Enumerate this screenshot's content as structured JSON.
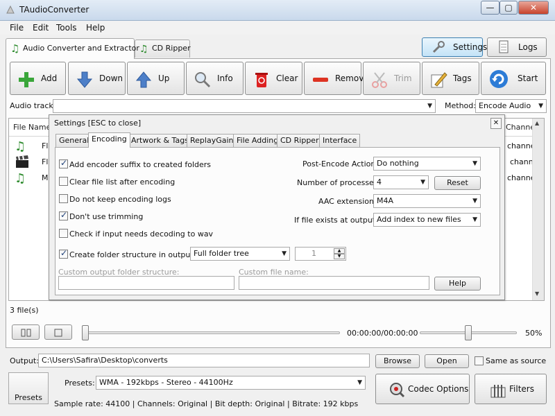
{
  "window": {
    "title": "TAudioConverter",
    "minimize": "—",
    "maximize": "▢",
    "close": "✕"
  },
  "menu": [
    "File",
    "Edit",
    "Tools",
    "Help"
  ],
  "main_tabs": [
    {
      "label": "Audio Converter and Extractor",
      "icon": "music-note-icon",
      "active": true
    },
    {
      "label": "CD Ripper",
      "icon": "music-note-icon",
      "active": false
    }
  ],
  "top_buttons": {
    "settings": "Settings",
    "logs": "Logs"
  },
  "toolbar": [
    {
      "label": "Add",
      "icon": "plus-icon",
      "enabled": true
    },
    {
      "label": "Down",
      "icon": "arrow-down-icon",
      "enabled": true
    },
    {
      "label": "Up",
      "icon": "arrow-up-icon",
      "enabled": true
    },
    {
      "label": "Info",
      "icon": "magnifier-icon",
      "enabled": true
    },
    {
      "label": "Clear",
      "icon": "trash-icon",
      "enabled": true
    },
    {
      "label": "Remove",
      "icon": "minus-icon",
      "enabled": true
    },
    {
      "label": "Trim",
      "icon": "scissors-icon",
      "enabled": false
    },
    {
      "label": "Tags",
      "icon": "pencil-icon",
      "enabled": true
    },
    {
      "label": "Start",
      "icon": "refresh-icon",
      "enabled": true
    }
  ],
  "audio_track": {
    "label": "Audio track:",
    "value": ""
  },
  "method": {
    "label": "Method:",
    "value": "Encode Audio"
  },
  "file_list": {
    "col_file_name": "File Name",
    "col_channels": "Channels",
    "rows": [
      {
        "name_fragment": "Fl",
        "icon": "music-note-icon",
        "channels": "channels"
      },
      {
        "name_fragment": "Fl",
        "icon": "film-clapper-icon",
        "channels": "channel"
      },
      {
        "name_fragment": "M",
        "icon": "music-note-icon",
        "channels": "channels"
      }
    ]
  },
  "settings_dialog": {
    "title": "Settings [ESC to close]",
    "tabs": [
      "General",
      "Encoding",
      "Artwork & Tags",
      "ReplayGain",
      "File Adding",
      "CD Ripper",
      "Interface"
    ],
    "active_tab": "Encoding",
    "checkboxes": [
      {
        "label": "Add encoder suffix to created folders",
        "checked": true
      },
      {
        "label": "Clear file list after encoding",
        "checked": false
      },
      {
        "label": "Do not keep encoding logs",
        "checked": false
      },
      {
        "label": "Don't use trimming",
        "checked": true
      },
      {
        "label": "Check if input needs decoding to wav",
        "checked": false
      },
      {
        "label": "Create folder structure in output",
        "checked": true
      }
    ],
    "folder_structure": {
      "value": "Full folder tree",
      "spin_value": "1"
    },
    "post_encode": {
      "label": "Post-Encode Action:",
      "value": "Do nothing"
    },
    "processes": {
      "label": "Number of processes:",
      "value": "4",
      "reset": "Reset"
    },
    "aac_extension": {
      "label": "AAC extension:",
      "value": "M4A"
    },
    "file_exists": {
      "label": "If file exists at output:",
      "value": "Add index to new files"
    },
    "custom_folder": {
      "label": "Custom output folder structure:",
      "value": ""
    },
    "custom_file": {
      "label": "Custom file name:",
      "value": ""
    },
    "help": "Help"
  },
  "file_count": "3 file(s)",
  "player": {
    "time": "00:00:00/00:00:00",
    "volume": "50%",
    "position": 0.0,
    "volume_level": 0.5
  },
  "output": {
    "label": "Output:",
    "path": "C:\\Users\\Safira\\Desktop\\converts",
    "browse": "Browse",
    "open": "Open",
    "same_as_source": "Same as source",
    "same_as_source_checked": false
  },
  "presets": {
    "button": "Presets",
    "label": "Presets:",
    "value": "WMA - 192kbps - Stereo - 44100Hz",
    "info": "Sample rate: 44100 | Channels: Original | Bit depth: Original | Bitrate: 192 kbps"
  },
  "bottom_buttons": {
    "codec_options": "Codec Options",
    "filters": "Filters"
  }
}
